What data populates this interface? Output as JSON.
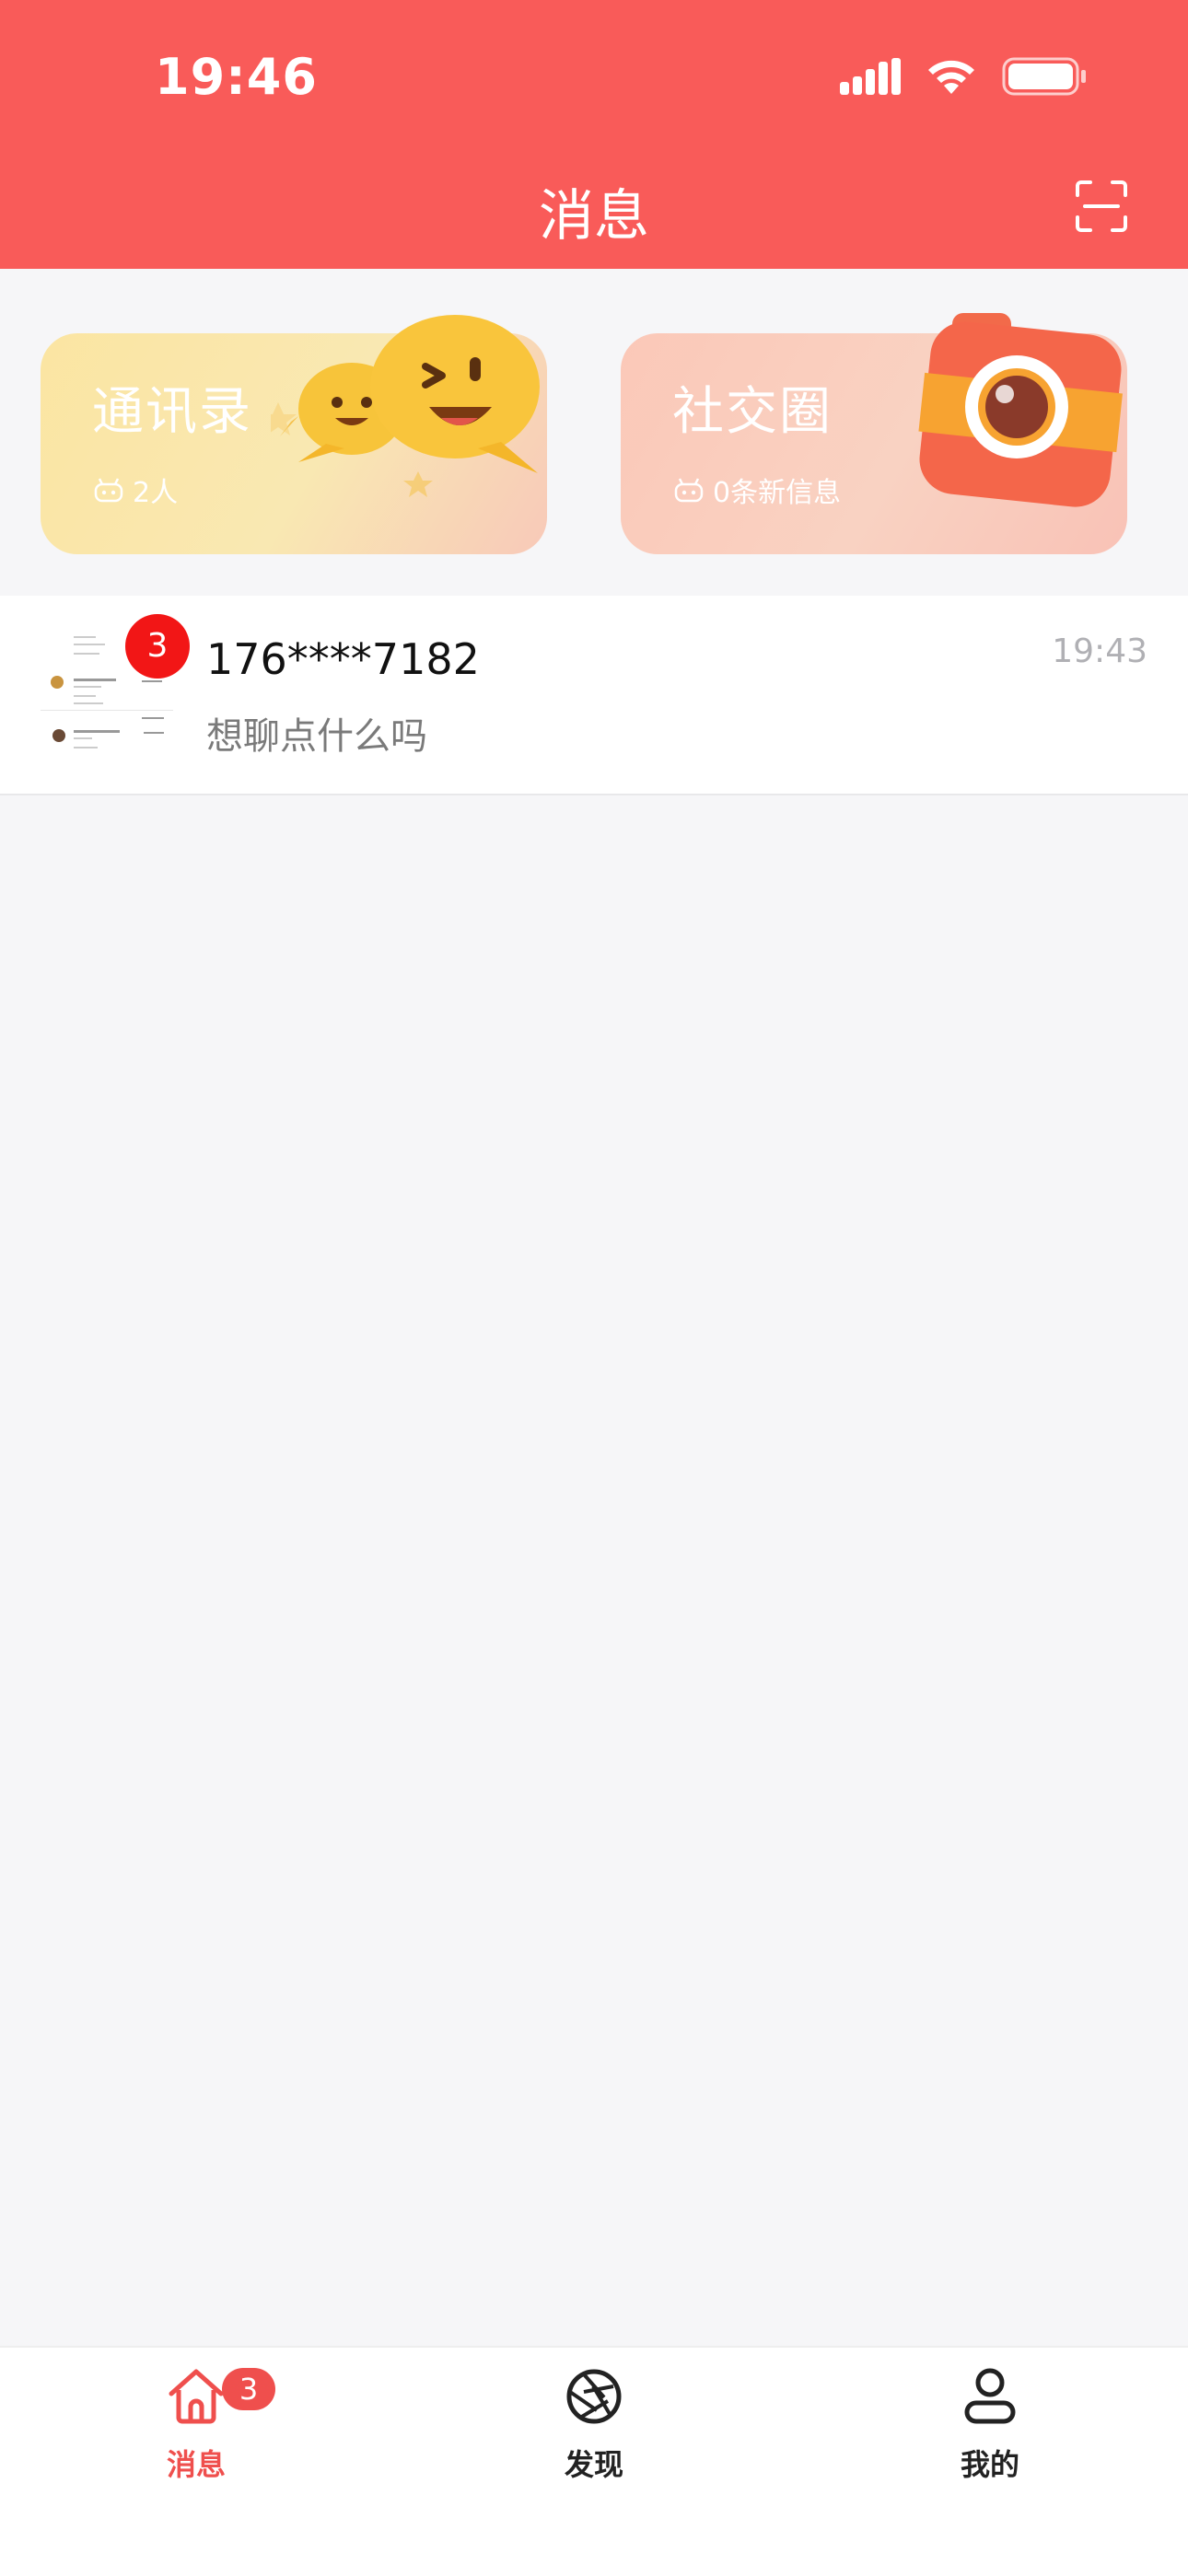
{
  "status_bar": {
    "time": "19:46"
  },
  "header": {
    "title": "消息"
  },
  "cards": {
    "contacts": {
      "title": "通讯录",
      "subtitle": "2人"
    },
    "social": {
      "title": "社交圈",
      "subtitle": "0条新信息"
    }
  },
  "conversations": [
    {
      "name": "176****7182",
      "message": "想聊点什么吗",
      "time": "19:43",
      "unread": "3"
    }
  ],
  "tabbar": {
    "items": [
      {
        "label": "消息",
        "badge": "3",
        "icon": "home-icon"
      },
      {
        "label": "发现",
        "icon": "aperture-icon"
      },
      {
        "label": "我的",
        "icon": "user-icon"
      }
    ]
  },
  "colors": {
    "brand": "#f95b59",
    "badge": "#f21616",
    "tab_active": "#ef4f4d"
  }
}
